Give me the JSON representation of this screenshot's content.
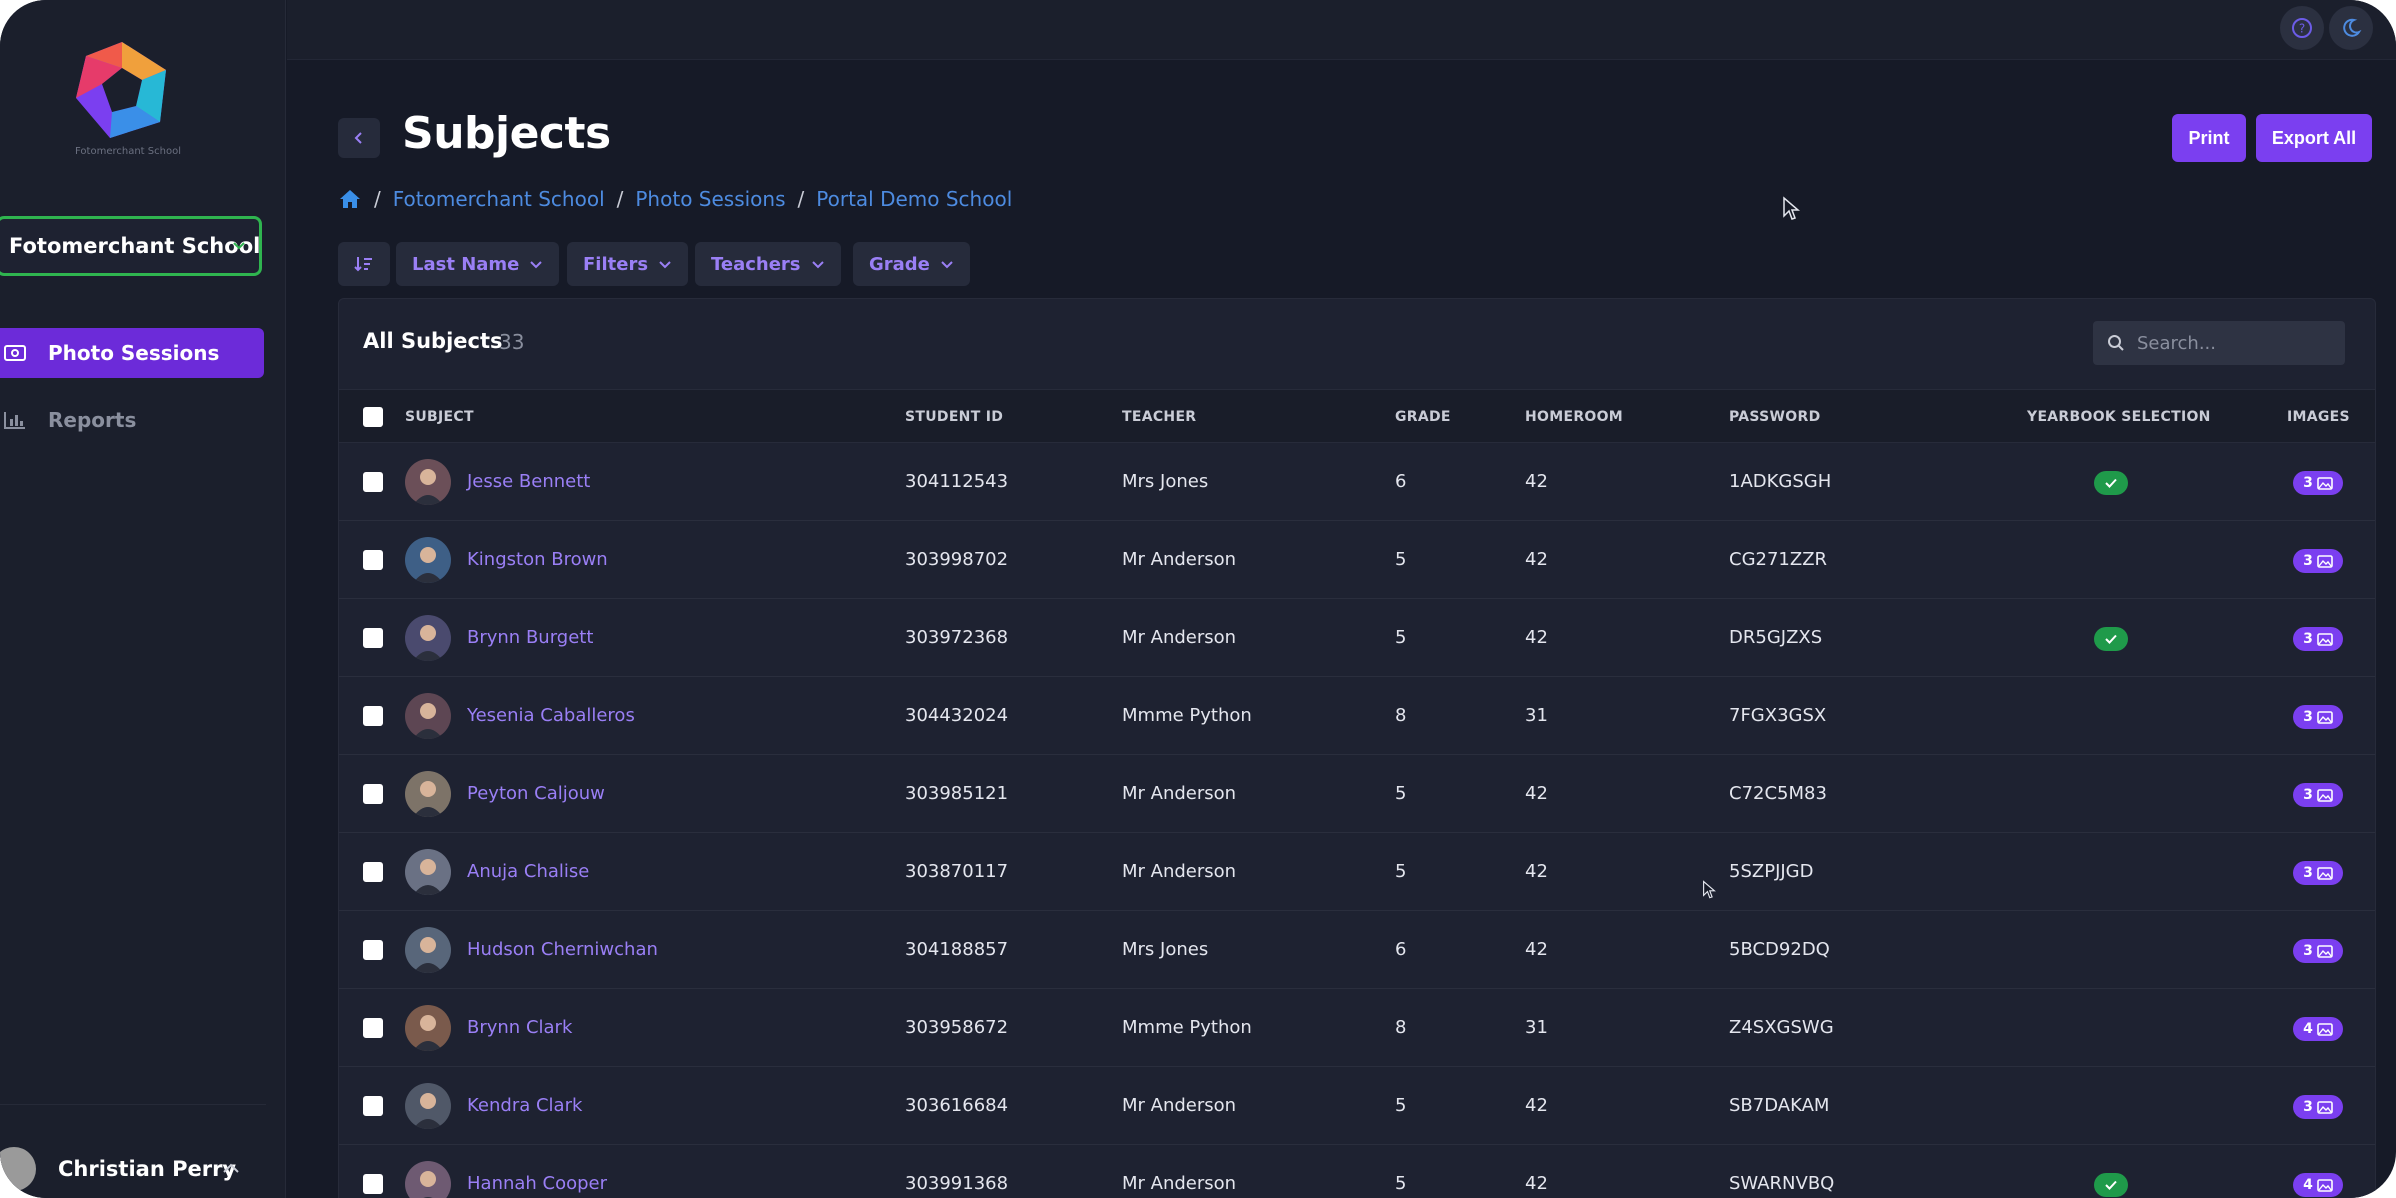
{
  "brand": {
    "logo_caption": "Fotomerchant School"
  },
  "sidebar": {
    "school_selector": "Fotomerchant School",
    "items": [
      {
        "label": "Photo Sessions",
        "icon": "camera-icon",
        "active": true
      },
      {
        "label": "Reports",
        "icon": "bar-chart-icon",
        "active": false
      }
    ],
    "user": {
      "name": "Christian Perry"
    }
  },
  "topbar": {
    "help_icon": "help-icon",
    "theme_icon": "moon-icon"
  },
  "header": {
    "title": "Subjects",
    "print_label": "Print",
    "export_label": "Export All",
    "breadcrumb": [
      "Fotomerchant School",
      "Photo Sessions",
      "Portal Demo School"
    ]
  },
  "filters": {
    "sort": "Last Name",
    "filters": "Filters",
    "teachers": "Teachers",
    "grade": "Grade"
  },
  "table": {
    "title": "All Subjects",
    "count": "33",
    "search_placeholder": "Search...",
    "columns": [
      "SUBJECT",
      "STUDENT ID",
      "TEACHER",
      "GRADE",
      "HOMEROOM",
      "PASSWORD",
      "YEARBOOK SELECTION",
      "IMAGES"
    ],
    "rows": [
      {
        "name": "Jesse Bennett",
        "student_id": "304112543",
        "teacher": "Mrs Jones",
        "grade": "6",
        "homeroom": "42",
        "password": "1ADKGSGH",
        "yearbook": true,
        "images": "3"
      },
      {
        "name": "Kingston Brown",
        "student_id": "303998702",
        "teacher": "Mr Anderson",
        "grade": "5",
        "homeroom": "42",
        "password": "CG271ZZR",
        "yearbook": false,
        "images": "3"
      },
      {
        "name": "Brynn Burgett",
        "student_id": "303972368",
        "teacher": "Mr Anderson",
        "grade": "5",
        "homeroom": "42",
        "password": "DR5GJZXS",
        "yearbook": true,
        "images": "3"
      },
      {
        "name": "Yesenia Caballeros",
        "student_id": "304432024",
        "teacher": "Mmme Python",
        "grade": "8",
        "homeroom": "31",
        "password": "7FGX3GSX",
        "yearbook": false,
        "images": "3"
      },
      {
        "name": "Peyton Caljouw",
        "student_id": "303985121",
        "teacher": "Mr Anderson",
        "grade": "5",
        "homeroom": "42",
        "password": "C72C5M83",
        "yearbook": false,
        "images": "3"
      },
      {
        "name": "Anuja Chalise",
        "student_id": "303870117",
        "teacher": "Mr Anderson",
        "grade": "5",
        "homeroom": "42",
        "password": "5SZPJJGD",
        "yearbook": false,
        "images": "3"
      },
      {
        "name": "Hudson Cherniwchan",
        "student_id": "304188857",
        "teacher": "Mrs Jones",
        "grade": "6",
        "homeroom": "42",
        "password": "5BCD92DQ",
        "yearbook": false,
        "images": "3"
      },
      {
        "name": "Brynn Clark",
        "student_id": "303958672",
        "teacher": "Mmme Python",
        "grade": "8",
        "homeroom": "31",
        "password": "Z4SXGSWG",
        "yearbook": false,
        "images": "4"
      },
      {
        "name": "Kendra Clark",
        "student_id": "303616684",
        "teacher": "Mr Anderson",
        "grade": "5",
        "homeroom": "42",
        "password": "SB7DAKAM",
        "yearbook": false,
        "images": "3"
      },
      {
        "name": "Hannah Cooper",
        "student_id": "303991368",
        "teacher": "Mr Anderson",
        "grade": "5",
        "homeroom": "42",
        "password": "SWARNVBQ",
        "yearbook": true,
        "images": "4"
      }
    ]
  },
  "colors": {
    "accent": "#7b3ff0",
    "link": "#4d8be0",
    "success": "#1f9a4a",
    "selector_border": "#2fb44f",
    "background": "#161a27"
  }
}
